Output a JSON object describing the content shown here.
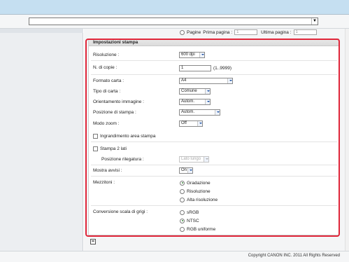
{
  "toolbar": {
    "select_value": ""
  },
  "pages_row": {
    "radio_label": "Pagine",
    "first_page_label": "Prima pagina :",
    "first_page_value": "1",
    "last_page_label": "Ultima pagina :",
    "last_page_value": "1"
  },
  "section": {
    "title": "Impostazioni stampa"
  },
  "fields": {
    "risoluzione": {
      "label": "Risoluzione :",
      "value": "600 dpi"
    },
    "copie": {
      "label": "N. di copie :",
      "value": "1",
      "hint": "(1..9999)"
    },
    "formato": {
      "label": "Formato carta :",
      "value": "A4"
    },
    "tipo": {
      "label": "Tipo di carta :",
      "value": "Comune"
    },
    "orientamento": {
      "label": "Orientamento immagine :",
      "value": "Autom."
    },
    "posizione": {
      "label": "Posizione di stampa :",
      "value": "Autom."
    },
    "zoom": {
      "label": "Modo zoom :",
      "value": "Off"
    },
    "ingrandimento": {
      "label": "Ingrandimento area stampa",
      "checked": false
    },
    "due_lati": {
      "label": "Stampa 2 lati",
      "checked": false
    },
    "rilegatura": {
      "label": "Posizione rilegatura :",
      "value": "Lato lungo"
    },
    "avvisi": {
      "label": "Mostra avvisi :",
      "value": "On"
    },
    "mezzitoni": {
      "label": "Mezzitoni :",
      "options": [
        "Gradazione",
        "Risoluzione",
        "Alta risoluzione"
      ],
      "selected": "Gradazione"
    },
    "grigi": {
      "label": "Conversione scala di grigi :",
      "options": [
        "sRGB",
        "NTSC",
        "RGB uniforme"
      ],
      "selected": "NTSC"
    }
  },
  "footer": {
    "copyright": "Copyright CANON INC. 2011 All Rights Reserved"
  },
  "colors": {
    "highlight_frame": "#e0263a",
    "titlebar": "#c5dff1"
  }
}
